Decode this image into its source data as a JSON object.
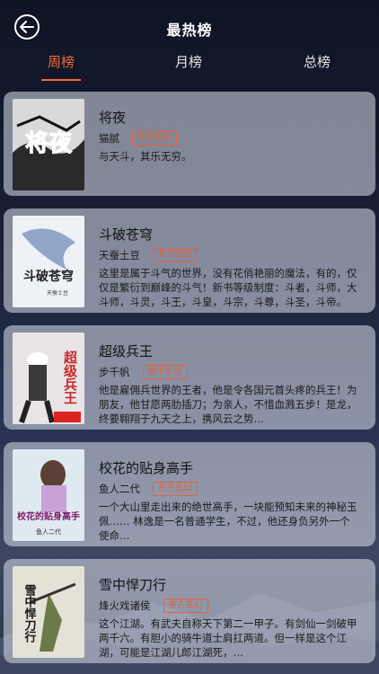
{
  "header": {
    "title": "最热榜"
  },
  "tabs": [
    {
      "label": "周榜",
      "active": true
    },
    {
      "label": "月榜",
      "active": false
    },
    {
      "label": "总榜",
      "active": false
    }
  ],
  "accent_color": "#f26a3c",
  "books": [
    {
      "title": "将夜",
      "author": "猫腻",
      "tag": "东方玄幻",
      "desc": "与天斗，其乐无穷。",
      "cover_text": "将夜"
    },
    {
      "title": "斗破苍穹",
      "author": "天蚕土豆",
      "tag": "东方玄幻",
      "desc": "这里是属于斗气的世界，没有花俏艳丽的魔法，有的，仅仅是繁衍到巅峰的斗气！新书等级制度：斗者，斗师，大斗师，斗灵，斗王，斗皇，斗宗，斗尊，斗圣，斗帝。",
      "cover_text": "斗破苍穹",
      "cover_author": "天蚕土豆"
    },
    {
      "title": "超级兵王",
      "author": "步千帆",
      "tag": "都市生活",
      "desc": "他是雇佣兵世界的王者，他是令各国元首头疼的兵王！为朋友，他甘愿两肋插刀；为亲人，不惜血溅五步！是龙，终要翱翔于九天之上，携风云之势…",
      "cover_text": "超级兵王"
    },
    {
      "title": "校花的贴身高手",
      "author": "鱼人二代",
      "tag": "东方玄幻",
      "desc": "一个大山里走出来的绝世高手，一块能预知未来的神秘玉佩……\n林逸是一名普通学生，不过，他还身负另外一个使命…",
      "cover_text": "校花的贴身高手",
      "cover_author": "鱼人二代"
    },
    {
      "title": "雪中悍刀行",
      "author": "烽火戏诸侯",
      "tag": "东方玄幻",
      "desc": "这个江湖。有武夫自称天下第二一甲子。有剑仙一剑破甲两千六。有胆小的骑牛道士肩扛两道。但一样是这个江湖，可能是江湖儿郎江湖死，…",
      "cover_text": "雪中悍刀行"
    }
  ]
}
